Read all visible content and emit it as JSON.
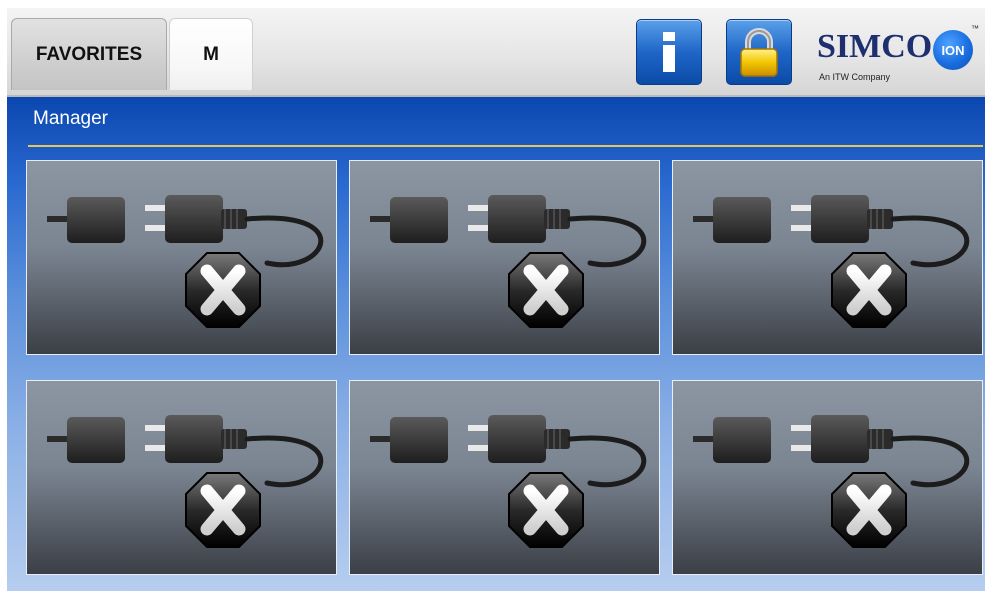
{
  "tabs": [
    {
      "label": "FAVORITES"
    },
    {
      "label": "M"
    }
  ],
  "toolbar": {
    "info_icon": "info-icon",
    "lock_icon": "padlock-icon"
  },
  "logo": {
    "brand": "SIMCO",
    "badge": "ION",
    "trademark": "™",
    "tagline": "An ITW Company"
  },
  "page": {
    "title": "Manager"
  },
  "devices": [
    {
      "icon": "disconnected-plug-icon",
      "status": "disconnected"
    },
    {
      "icon": "disconnected-plug-icon",
      "status": "disconnected"
    },
    {
      "icon": "disconnected-plug-icon",
      "status": "disconnected"
    },
    {
      "icon": "disconnected-plug-icon",
      "status": "disconnected"
    },
    {
      "icon": "disconnected-plug-icon",
      "status": "disconnected"
    },
    {
      "icon": "disconnected-plug-icon",
      "status": "disconnected"
    }
  ],
  "colors": {
    "header_blue": "#0a47b0",
    "rule_gold": "#e4c75a",
    "brand_navy": "#1d2f6e"
  }
}
